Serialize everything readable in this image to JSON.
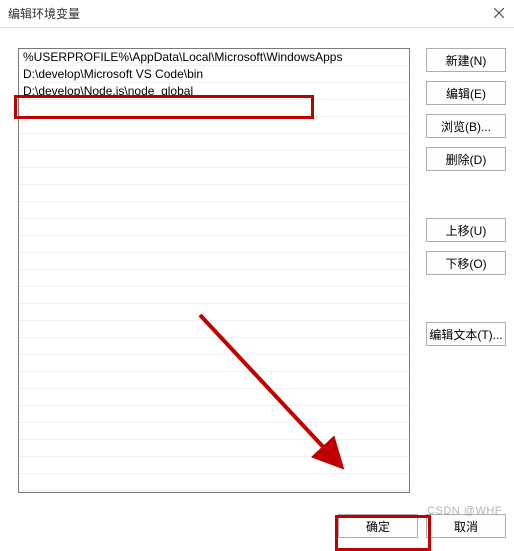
{
  "window": {
    "title": "编辑环境变量",
    "close_tooltip": "关闭"
  },
  "entries": {
    "items": [
      "%USERPROFILE%\\AppData\\Local\\Microsoft\\WindowsApps",
      "D:\\develop\\Microsoft VS Code\\bin",
      "D:\\develop\\Node.js\\node_global"
    ],
    "blank_rows": 23
  },
  "buttons": {
    "new": "新建(N)",
    "edit": "编辑(E)",
    "browse": "浏览(B)...",
    "delete": "删除(D)",
    "move_up": "上移(U)",
    "move_down": "下移(O)",
    "edit_text": "编辑文本(T)...",
    "ok": "确定",
    "cancel": "取消"
  },
  "watermark": "CSDN @WHF",
  "annotations": {
    "highlight_entry_index": 2,
    "arrow_target": "ok"
  }
}
